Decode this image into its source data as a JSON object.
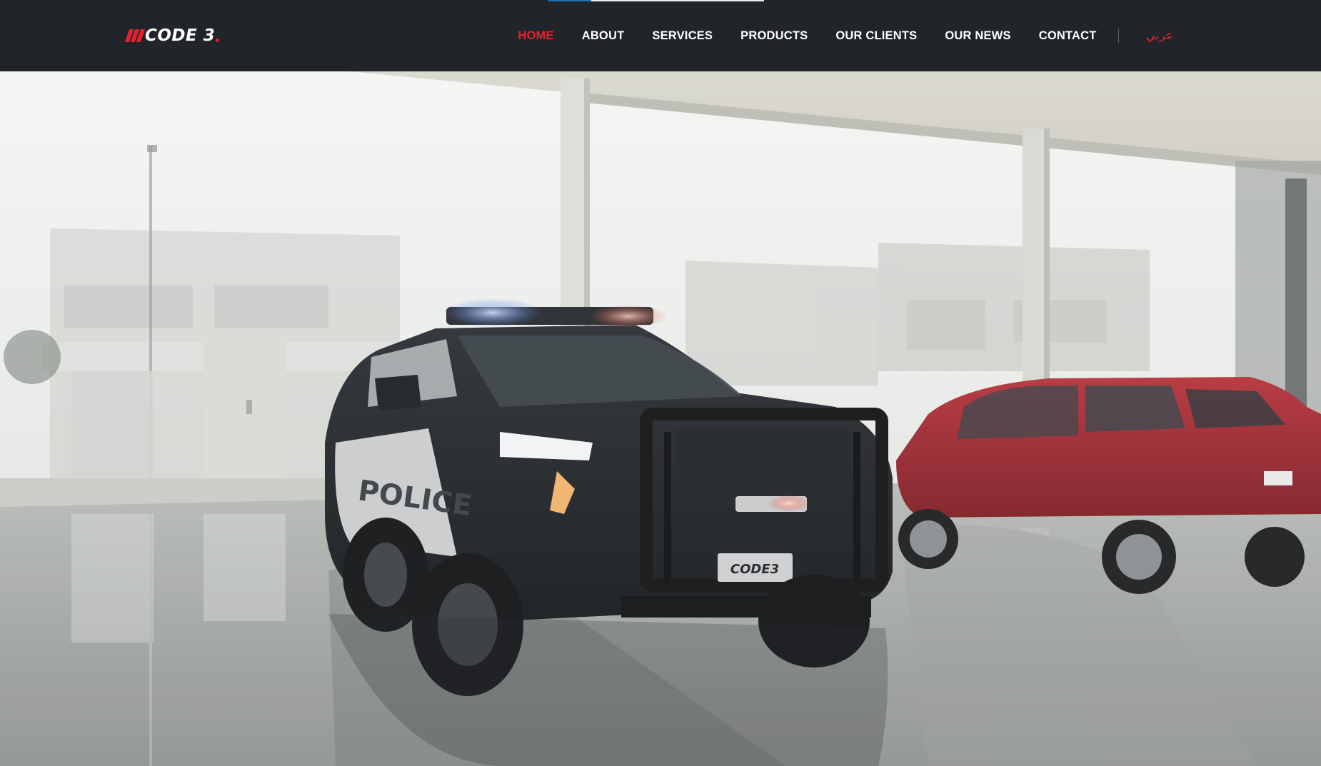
{
  "header": {
    "logo_text": "CODE 3",
    "logo_name": "code3-logo"
  },
  "nav": {
    "items": [
      {
        "label": "HOME",
        "active": true
      },
      {
        "label": "ABOUT",
        "active": false
      },
      {
        "label": "SERVICES",
        "active": false
      },
      {
        "label": "PRODUCTS",
        "active": false
      },
      {
        "label": "OUR CLIENTS",
        "active": false
      },
      {
        "label": "OUR NEWS",
        "active": false
      },
      {
        "label": "CONTACT",
        "active": false
      }
    ],
    "language_switch": "عربي"
  },
  "progress": {
    "fraction": 0.2
  },
  "hero": {
    "media_type": "video",
    "vehicle_plate": "CODE3",
    "vehicle_door_text": "POLICE"
  },
  "colors": {
    "header_bg": "#212529",
    "accent": "#e3232b",
    "nav_text": "#ffffff",
    "progress": "#1f6fb5"
  }
}
